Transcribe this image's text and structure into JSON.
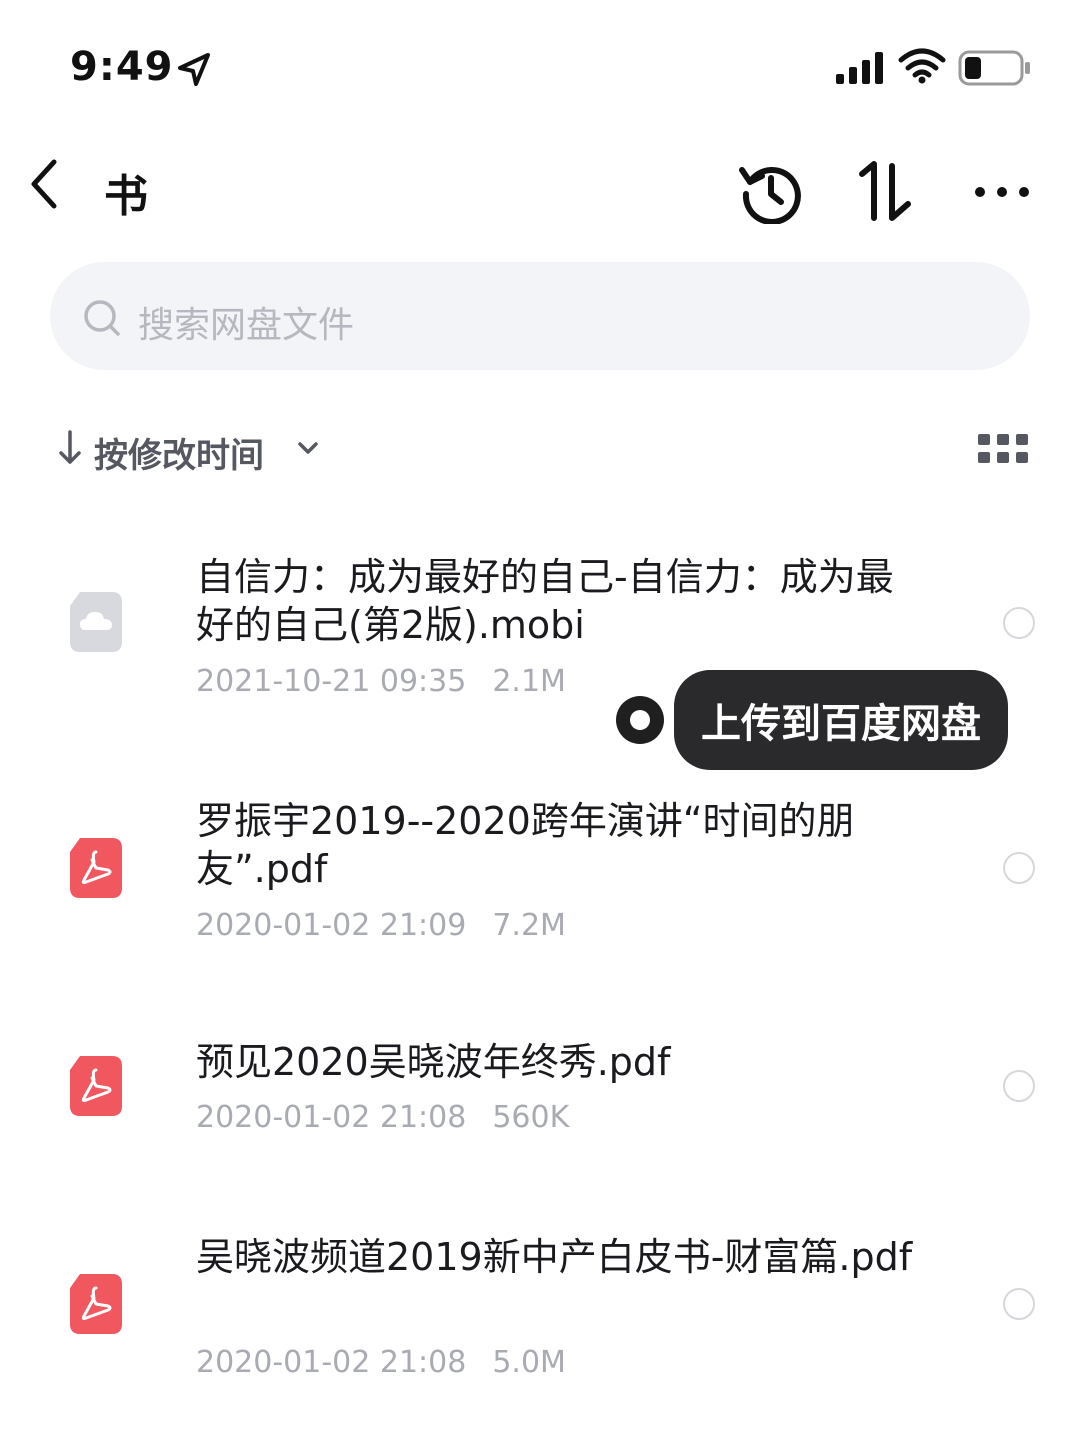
{
  "status_bar": {
    "time": "9:49"
  },
  "nav": {
    "title": "书"
  },
  "search": {
    "placeholder": "搜索网盘文件"
  },
  "sort": {
    "label": "按修改时间"
  },
  "files": [
    {
      "name": "自信力：成为最好的自己-自信力：成为最好的自己(第2版).mobi",
      "date": "2021-10-21 09:35",
      "size": "2.1M",
      "type": "mobi"
    },
    {
      "name": "罗振宇2019--2020跨年演讲“时间的朋友”.pdf",
      "date": "2020-01-02 21:09",
      "size": "7.2M",
      "type": "pdf"
    },
    {
      "name": "预见2020吴晓波年终秀.pdf",
      "date": "2020-01-02 21:08",
      "size": "560K",
      "type": "pdf"
    },
    {
      "name": "吴晓波频道2019新中产白皮书-财富篇.pdf",
      "date": "2020-01-02 21:08",
      "size": "5.0M",
      "type": "pdf"
    }
  ],
  "tooltip": {
    "label": "上传到百度网盘"
  },
  "colors": {
    "pdf": "#f0575f",
    "mobi": "#d7d9de",
    "tooltip_bg": "#2a2a2c"
  }
}
